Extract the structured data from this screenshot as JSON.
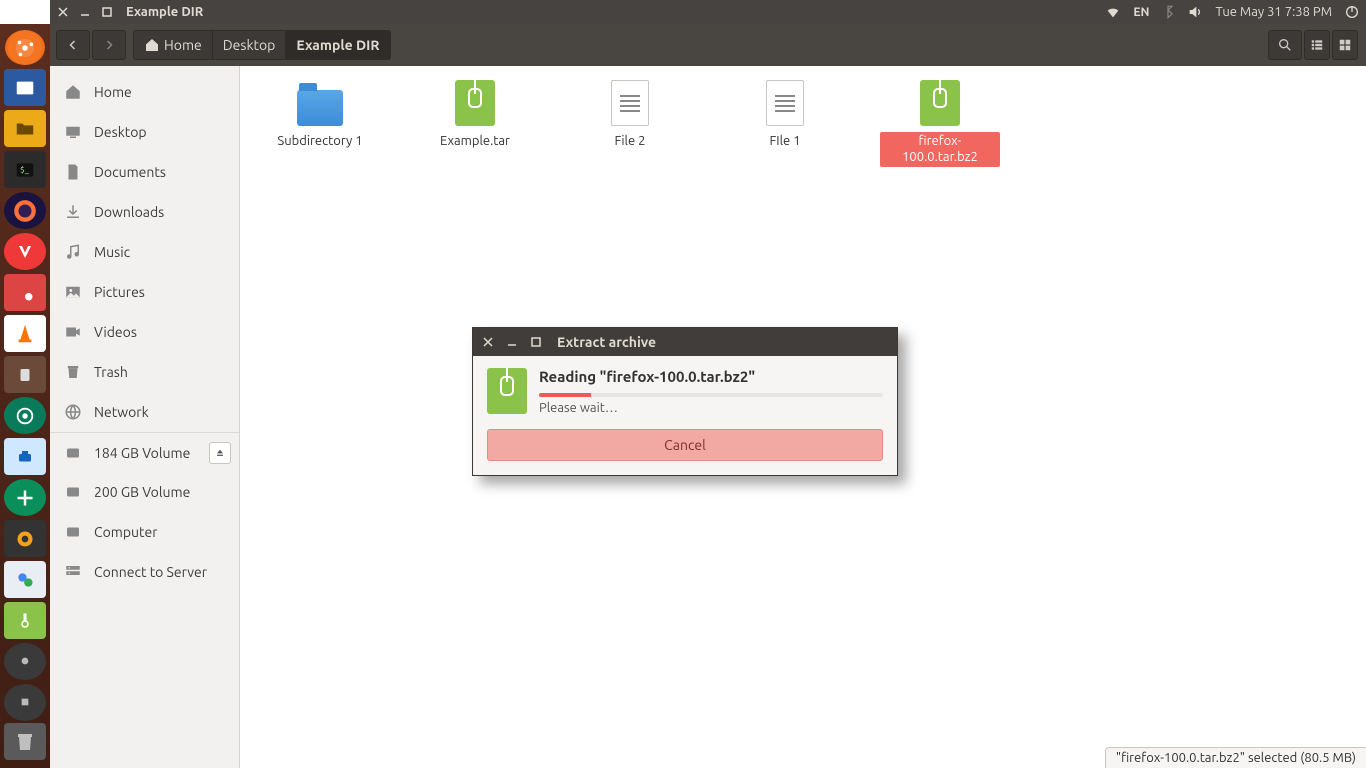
{
  "menubar": {
    "window_title": "Example DIR",
    "language": "EN",
    "clock": "Tue May 31  7:38 PM"
  },
  "toolbar": {
    "breadcrumb": [
      "Home",
      "Desktop",
      "Example DIR"
    ]
  },
  "sidebar": {
    "items": [
      {
        "label": "Home",
        "icon": "home"
      },
      {
        "label": "Desktop",
        "icon": "desktop"
      },
      {
        "label": "Documents",
        "icon": "document"
      },
      {
        "label": "Downloads",
        "icon": "download"
      },
      {
        "label": "Music",
        "icon": "music"
      },
      {
        "label": "Pictures",
        "icon": "picture"
      },
      {
        "label": "Videos",
        "icon": "video"
      },
      {
        "label": "Trash",
        "icon": "trash"
      },
      {
        "label": "Network",
        "icon": "network"
      }
    ],
    "devices": [
      {
        "label": "184 GB Volume",
        "eject": true
      },
      {
        "label": "200 GB Volume",
        "eject": false
      },
      {
        "label": "Computer",
        "eject": false
      },
      {
        "label": "Connect to Server",
        "eject": false
      }
    ]
  },
  "files": [
    {
      "label": "Subdirectory 1",
      "type": "folder"
    },
    {
      "label": "Example.tar",
      "type": "archive"
    },
    {
      "label": "File 2",
      "type": "text"
    },
    {
      "label": "FIle 1",
      "type": "text"
    },
    {
      "label": "firefox-100.0.tar.bz2",
      "type": "archive",
      "selected": true
    }
  ],
  "dialog": {
    "title": "Extract archive",
    "heading": "Reading \"firefox-100.0.tar.bz2\"",
    "wait_text": "Please wait…",
    "cancel_label": "Cancel"
  },
  "statusbar": {
    "text": "\"firefox-100.0.tar.bz2\" selected  (80.5 MB)"
  }
}
